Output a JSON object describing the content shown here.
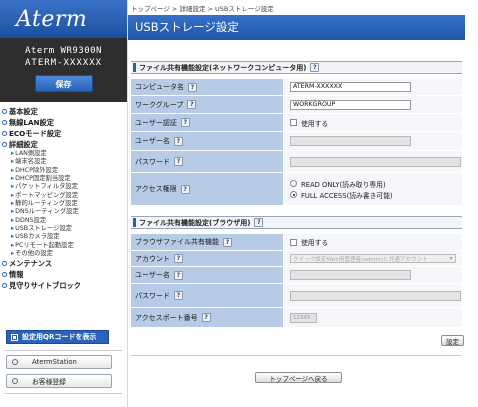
{
  "sidebar": {
    "logo": "Aterm",
    "model": "Aterm WR9300N",
    "device_id": "ATERM-XXXXXX",
    "save_label": "保存",
    "nav": [
      {
        "label": "基本設定",
        "level": 0
      },
      {
        "label": "無線LAN設定",
        "level": 0
      },
      {
        "label": "ECOモード設定",
        "level": 0
      },
      {
        "label": "詳細設定",
        "level": 0
      },
      {
        "label": "LAN側設定",
        "level": 1
      },
      {
        "label": "端末名設定",
        "level": 1
      },
      {
        "label": "DHCP除外設定",
        "level": 1
      },
      {
        "label": "DHCP固定割当設定",
        "level": 1
      },
      {
        "label": "パケットフィルタ設定",
        "level": 1
      },
      {
        "label": "ポートマッピング設定",
        "level": 1
      },
      {
        "label": "静的ルーティング設定",
        "level": 1
      },
      {
        "label": "DNSルーティング設定",
        "level": 1
      },
      {
        "label": "DDNS設定",
        "level": 1
      },
      {
        "label": "USBストレージ設定",
        "level": 1
      },
      {
        "label": "USBカメラ設定",
        "level": 1
      },
      {
        "label": "PCリモート起動設定",
        "level": 1
      },
      {
        "label": "その他の設定",
        "level": 1
      },
      {
        "label": "メンテナンス",
        "level": 0
      },
      {
        "label": "情報",
        "level": 0
      },
      {
        "label": "見守りサイトブロック",
        "level": 0
      }
    ],
    "qr_label": "設定用QRコードを表示",
    "aterm_station": "AtermStation",
    "customer_reg": "お客様登録",
    "bottom_text": "…"
  },
  "main": {
    "breadcrumb": "トップページ > 詳細設定 > USBストレージ設定",
    "title": "USBストレージ設定",
    "section1": {
      "heading": "ファイル共有機能設定(ネットワークコンピュータ用)",
      "computer_name": {
        "label": "コンピュータ名",
        "value": "ATERM-XXXXXX"
      },
      "workgroup": {
        "label": "ワークグループ",
        "value": "WORKGROUP"
      },
      "user_auth": {
        "label": "ユーザー認証",
        "option": "使用する"
      },
      "username": {
        "label": "ユーザー名",
        "value": ""
      },
      "password": {
        "label": "パスワード",
        "value": ""
      },
      "access": {
        "label": "アクセス権限",
        "opt1": "READ ONLY(読み取り専用)",
        "opt2": "FULL ACCESS(読み書き可能)",
        "selected": "opt2"
      }
    },
    "section2": {
      "heading": "ファイル共有機能設定(ブラウザ用)",
      "browser_share": {
        "label": "ブラウザファイル共有機能",
        "option": "使用する"
      },
      "account": {
        "label": "アカウント",
        "value": "クイック設定Web用管理者(admin)と共通アカウント"
      },
      "username": {
        "label": "ユーザー名",
        "value": ""
      },
      "password": {
        "label": "パスワード",
        "value": ""
      },
      "access_port": {
        "label": "アクセスポート番号",
        "value": "12345"
      }
    },
    "apply_label": "設定",
    "back_label": "トップページへ戻る"
  },
  "colors": {
    "accent": "#2a63b8",
    "label_bg": "#b7cbe6"
  }
}
